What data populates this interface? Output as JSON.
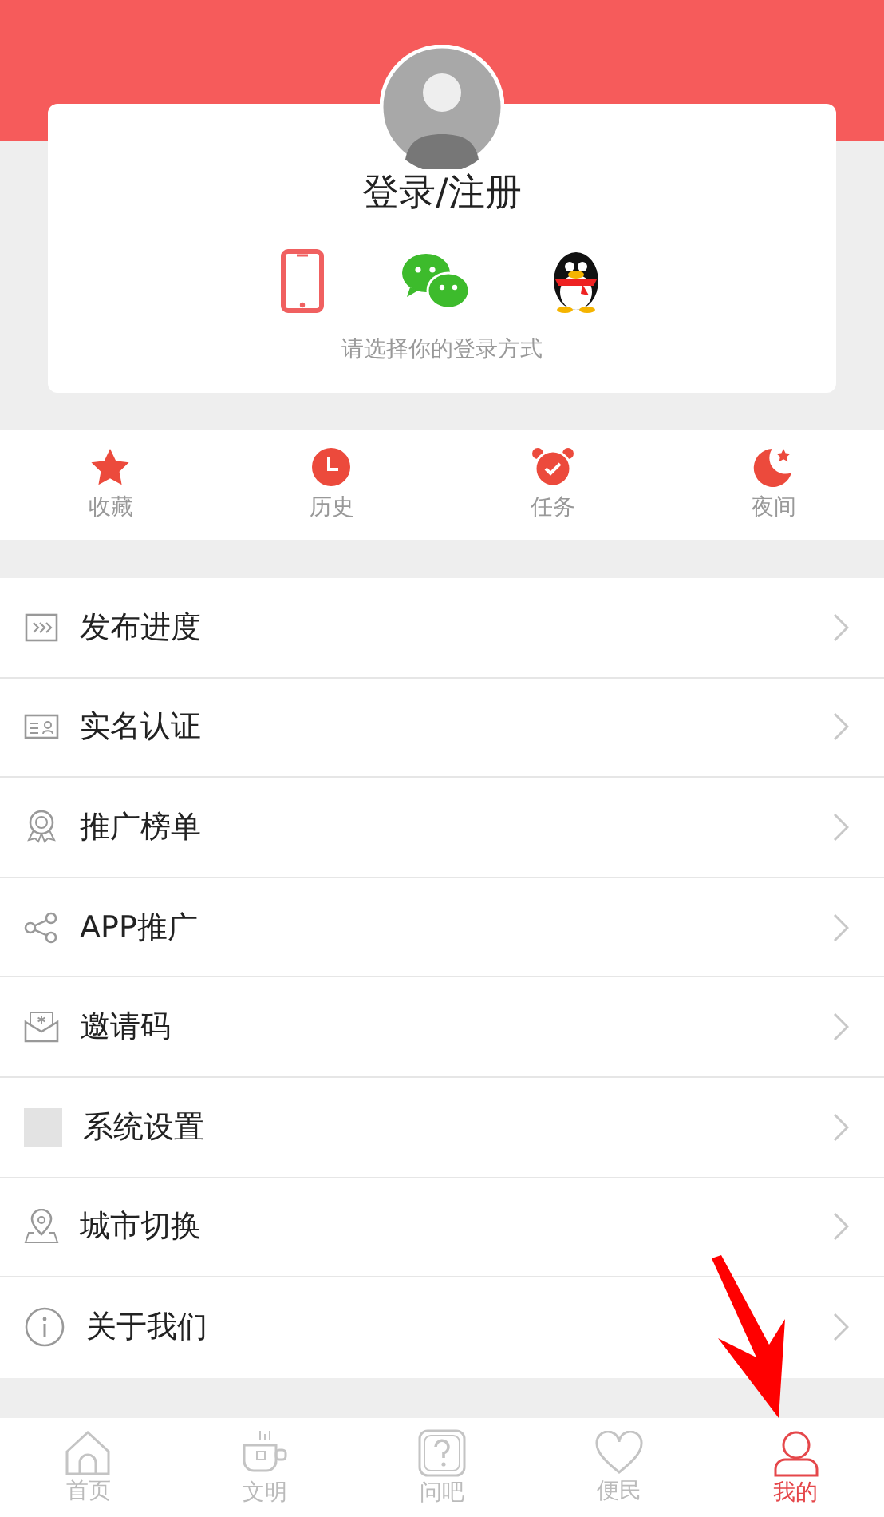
{
  "profile": {
    "title": "登录/注册",
    "hint": "请选择你的登录方式"
  },
  "quick_actions": [
    {
      "label": "收藏"
    },
    {
      "label": "历史"
    },
    {
      "label": "任务"
    },
    {
      "label": "夜间"
    }
  ],
  "menu": [
    {
      "label": "发布进度"
    },
    {
      "label": "实名认证"
    },
    {
      "label": "推广榜单"
    },
    {
      "label": "APP推广"
    },
    {
      "label": "邀请码"
    },
    {
      "label": "系统设置"
    },
    {
      "label": "城市切换"
    },
    {
      "label": "关于我们"
    }
  ],
  "tab_bar": [
    {
      "label": "首页",
      "selected": false
    },
    {
      "label": "文明",
      "selected": false
    },
    {
      "label": "问吧",
      "selected": false
    },
    {
      "label": "便民",
      "selected": false
    },
    {
      "label": "我的",
      "selected": true
    }
  ]
}
